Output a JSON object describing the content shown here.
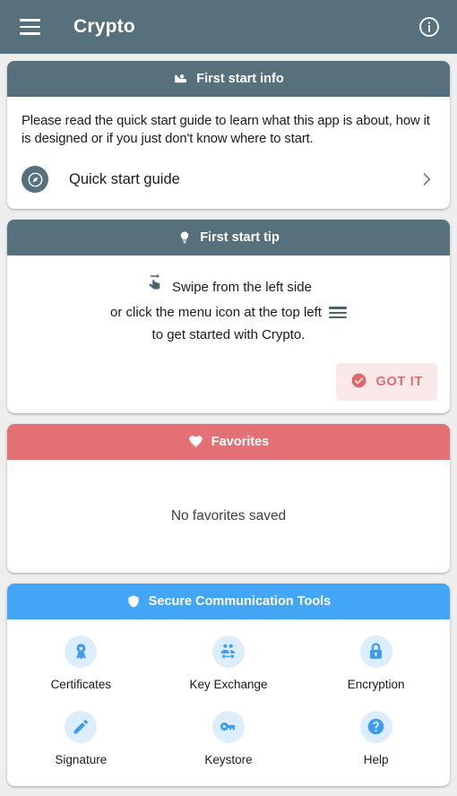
{
  "appbar": {
    "title": "Crypto",
    "menu_icon": "hamburger-menu-icon",
    "info_icon": "info-circle-icon",
    "background": "#56707c"
  },
  "cards": {
    "first_start_info": {
      "header_title": "First start info",
      "header_icon": "raised-hand-person-icon",
      "header_color": "#56707c",
      "body_text": "Please read the quick start guide to learn what this app is about, how it is designed or if you just don't know where to start.",
      "guide_row": {
        "label": "Quick start guide",
        "icon": "compass-explore-icon",
        "chevron": "chevron-right-icon"
      }
    },
    "first_start_tip": {
      "header_title": "First start tip",
      "header_icon": "lightbulb-icon",
      "header_color": "#56707c",
      "line1": "Swipe from the left side",
      "line1_icon": "swipe-right-gesture-icon",
      "line2": "or click the menu icon at the top left",
      "line2_icon": "hamburger-menu-icon",
      "line3": "to get started with Crypto.",
      "button": {
        "label": "GOT IT",
        "icon": "check-circle-icon",
        "bg": "#fbe9e9",
        "fg": "#e06a6e"
      }
    },
    "favorites": {
      "header_title": "Favorites",
      "header_icon": "heart-icon",
      "header_color": "#e37074",
      "empty_text": "No favorites saved"
    },
    "secure_tools": {
      "header_title": "Secure Communication Tools",
      "header_icon": "shield-icon",
      "header_color": "#42a5f5",
      "tools": [
        {
          "label": "Certificates",
          "icon": "award-ribbon-icon"
        },
        {
          "label": "Key Exchange",
          "icon": "people-exchange-icon"
        },
        {
          "label": "Encryption",
          "icon": "lock-icon"
        },
        {
          "label": "Signature",
          "icon": "pencil-icon"
        },
        {
          "label": "Keystore",
          "icon": "key-icon"
        },
        {
          "label": "Help",
          "icon": "help-circle-icon"
        }
      ]
    }
  }
}
